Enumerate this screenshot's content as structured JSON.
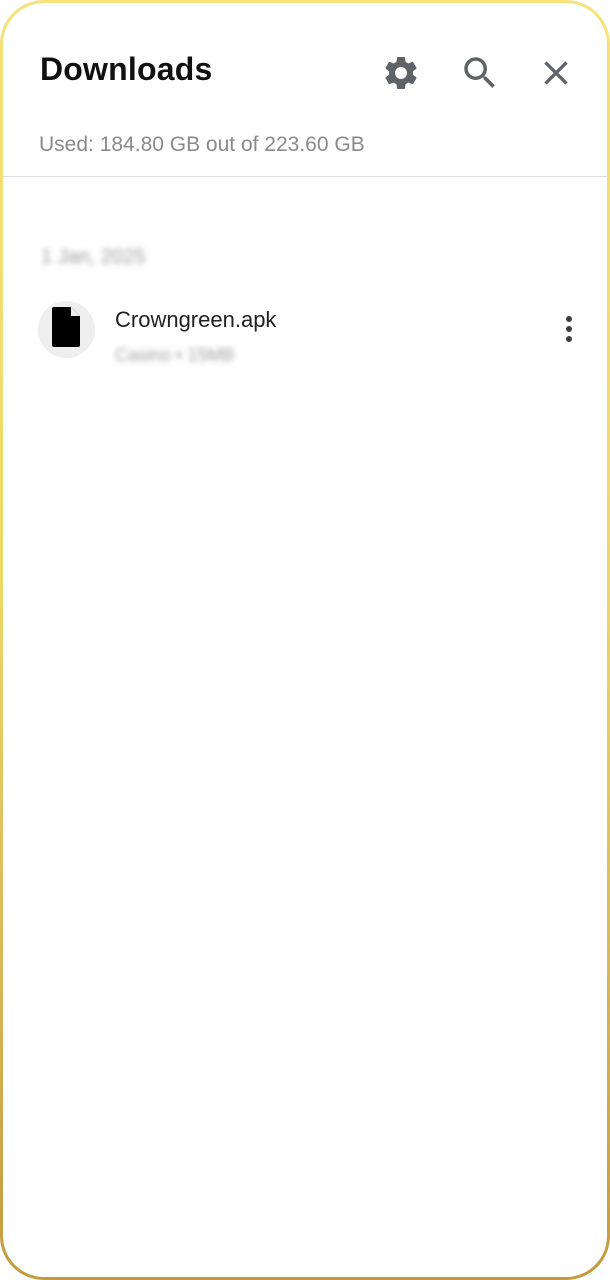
{
  "header": {
    "title": "Downloads",
    "settings_icon": "gear-icon",
    "search_icon": "search-icon",
    "close_icon": "close-icon"
  },
  "storage": {
    "text": "Used: 184.80 GB out of 223.60 GB"
  },
  "downloads": {
    "groups": [
      {
        "date": "1 Jan, 2025",
        "items": [
          {
            "name": "Crowngreen.apk",
            "meta": "Casino • 15MB",
            "icon": "file-icon",
            "menu_icon": "more-vert-icon"
          }
        ]
      }
    ]
  },
  "colors": {
    "frame_gold_top": "#f6e27a",
    "frame_gold_bottom": "#c49a3e",
    "icon_gray": "#5f6368",
    "text_primary": "#111111",
    "text_secondary": "#8a8a8a"
  }
}
